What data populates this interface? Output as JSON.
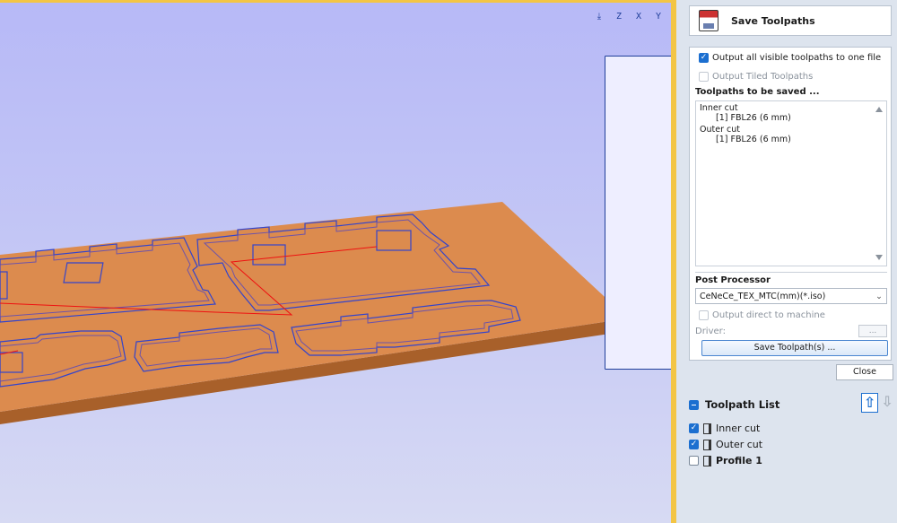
{
  "panel": {
    "title": "Save Toolpaths",
    "output_all_label": "Output all visible toolpaths to one file",
    "output_tiled_label": "Output Tiled Toolpaths",
    "toolpaths_header": "Toolpaths to be saved ...",
    "toolpaths": [
      {
        "name": "Inner cut",
        "tool": "[1] FBL26 (6 mm)"
      },
      {
        "name": "Outer cut",
        "tool": "[1] FBL26 (6 mm)"
      }
    ],
    "post_processor_label": "Post Processor",
    "post_processor_value": "CeNeCe_TEX_MTC(mm)(*.iso)",
    "output_direct_label": "Output direct to machine",
    "driver_label": "Driver:",
    "driver_button": "...",
    "save_button": "Save Toolpath(s) ...",
    "close_button": "Close"
  },
  "toolpath_list": {
    "title": "Toolpath List",
    "items": [
      {
        "label": "Inner cut",
        "checked": true
      },
      {
        "label": "Outer cut",
        "checked": true
      },
      {
        "label": "Profile 1",
        "checked": false
      }
    ]
  },
  "view_icons": [
    "fit-view-icon",
    "iso-view-icon",
    "z-view-icon",
    "x-view-icon",
    "y-view-icon"
  ],
  "colors": {
    "accent": "#1c6fd0",
    "viewport_border": "#f3c545",
    "board": "#d8874a"
  }
}
